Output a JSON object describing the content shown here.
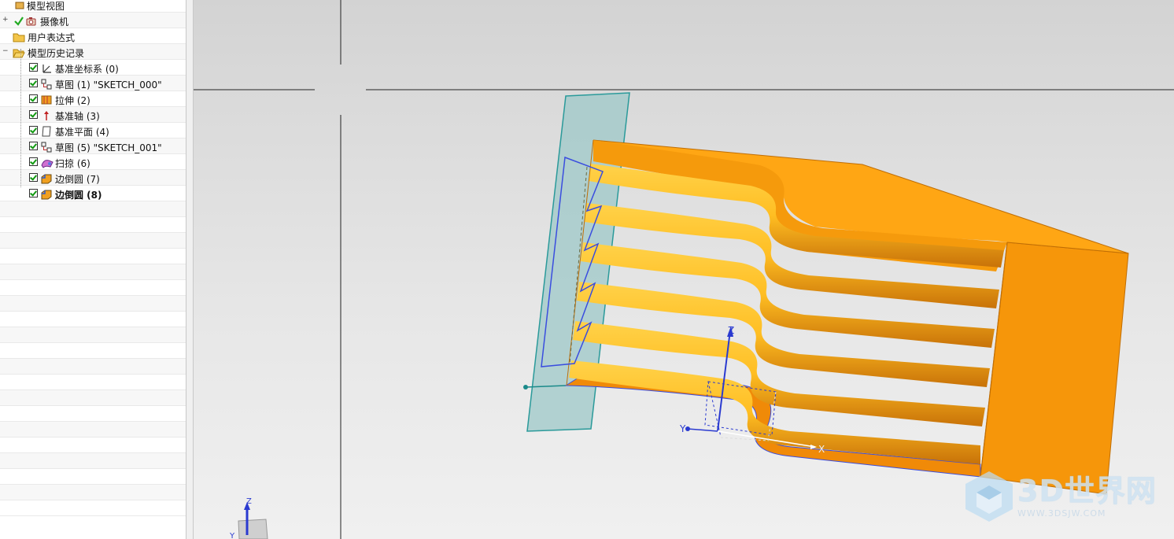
{
  "navigator": {
    "items": [
      {
        "label": "模型视图",
        "level": 0
      },
      {
        "label": "摄像机",
        "level": 0
      },
      {
        "label": "用户表达式",
        "level": 0
      },
      {
        "label": "模型历史记录",
        "level": 0
      },
      {
        "label": "基准坐标系 (0)",
        "level": 1
      },
      {
        "label": "草图 (1) \"SKETCH_000\"",
        "level": 1
      },
      {
        "label": "拉伸 (2)",
        "level": 1
      },
      {
        "label": "基准轴 (3)",
        "level": 1
      },
      {
        "label": "基准平面 (4)",
        "level": 1
      },
      {
        "label": "草图 (5) \"SKETCH_001\"",
        "level": 1
      },
      {
        "label": "扫掠 (6)",
        "level": 1
      },
      {
        "label": "边倒圆 (7)",
        "level": 1
      },
      {
        "label": "边倒圆 (8)",
        "level": 1
      }
    ]
  },
  "viewport": {
    "csys_labels": {
      "z": "Z",
      "y": "Y",
      "x": "X"
    },
    "triad_labels": {
      "z": "Z",
      "y": "Y"
    },
    "colors": {
      "part": "#f59a0c",
      "part_top": "#ffa61a",
      "datum_plane": "#9ec8c8",
      "sketch_curve": "#3a4ddf"
    }
  },
  "watermark": {
    "text": "3D世界网",
    "sub": "WWW.3DSJW.COM"
  }
}
